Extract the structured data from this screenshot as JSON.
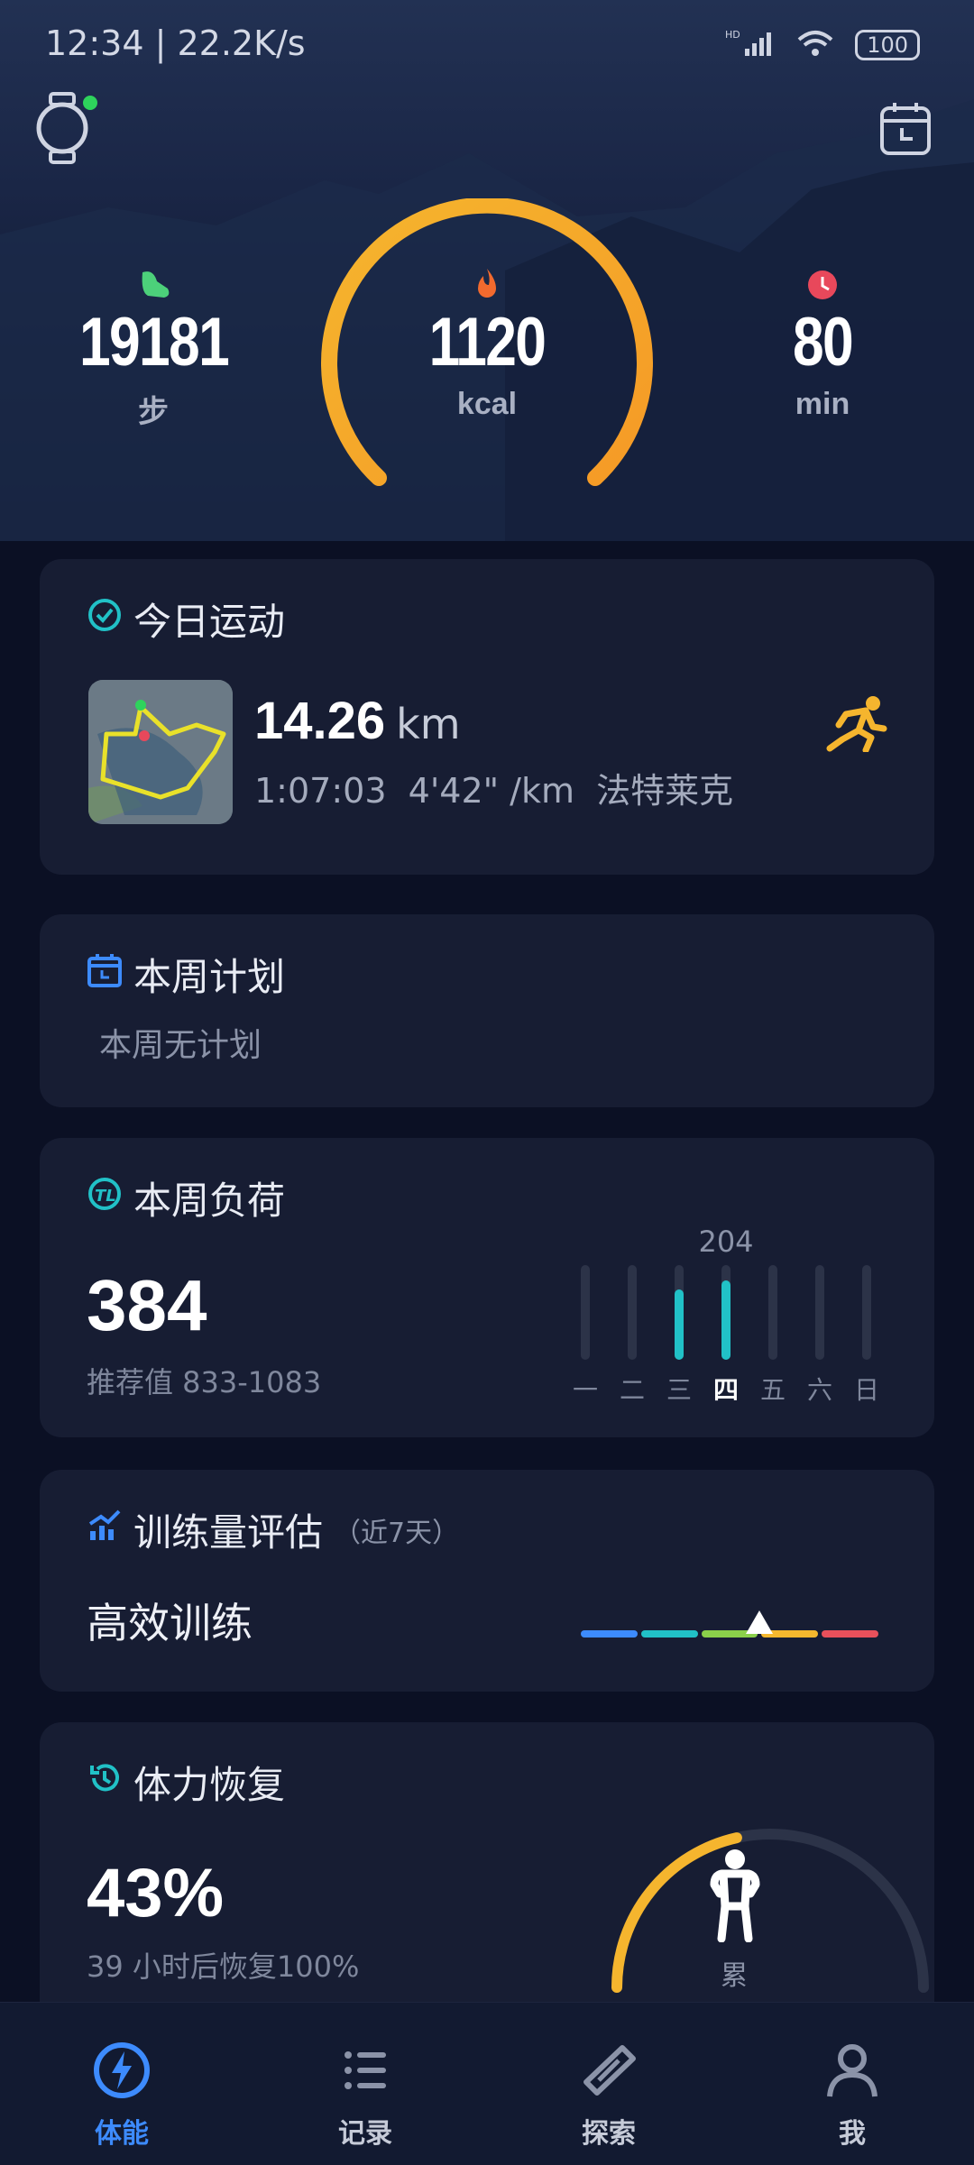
{
  "status_bar": {
    "time_speed": "12:34 | 22.2K/s",
    "battery": "100",
    "signal_label": "HD"
  },
  "header": {
    "left_icon": "watch-icon",
    "right_icon": "calendar-icon"
  },
  "summary": {
    "steps": {
      "value": "19181",
      "unit": "步",
      "icon": "footprint-icon"
    },
    "calories": {
      "value": "1120",
      "unit": "kcal",
      "icon": "flame-icon"
    },
    "minutes": {
      "value": "80",
      "unit": "min",
      "icon": "clock-icon"
    },
    "ring_color": "#f5a623"
  },
  "today_workout": {
    "title": "今日运动",
    "distance": "14.26",
    "distance_unit": "km",
    "details": "1:07:03  4'42\" /km  法特莱克",
    "activity_icon": "running-icon"
  },
  "weekly_plan": {
    "title": "本周计划",
    "text": "本周无计划"
  },
  "weekly_load": {
    "title": "本周负荷",
    "value": "384",
    "recommended": "推荐值 833-1083",
    "peak_label": "204",
    "days": [
      "一",
      "二",
      "三",
      "四",
      "五",
      "六",
      "日"
    ],
    "day_load": [
      0,
      0,
      180,
      204,
      0,
      0,
      0
    ],
    "today_index": 3
  },
  "training_eval": {
    "title": "训练量评估",
    "subtitle": "（近7天）",
    "status": "高效训练",
    "scale_colors": [
      "#3d8bfd",
      "#21c1c7",
      "#8bd04a",
      "#f5b82e",
      "#e8505b"
    ],
    "marker_position": 0.6
  },
  "recovery": {
    "title": "体力恢复",
    "percent": "43%",
    "percent_value": 43,
    "note": "39 小时后恢复100%",
    "state": "累"
  },
  "bottom_nav": [
    {
      "label": "体能",
      "icon": "bolt-icon",
      "active": true
    },
    {
      "label": "记录",
      "icon": "list-icon",
      "active": false
    },
    {
      "label": "探索",
      "icon": "compass-icon",
      "active": false
    },
    {
      "label": "我",
      "icon": "user-icon",
      "active": false
    }
  ]
}
